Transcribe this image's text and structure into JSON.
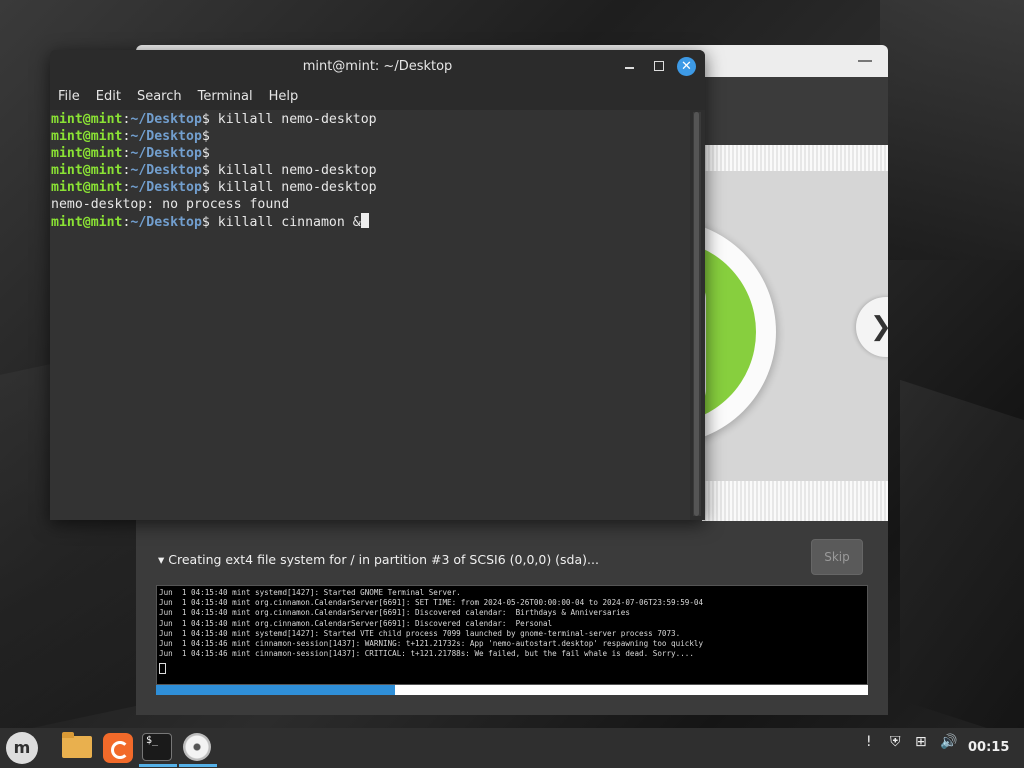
{
  "terminal": {
    "title": "mint@mint: ~/Desktop",
    "menu": [
      "File",
      "Edit",
      "Search",
      "Terminal",
      "Help"
    ],
    "prompt": {
      "user": "mint@mint",
      "sep": ":",
      "path": "~/Desktop",
      "symbol": "$"
    },
    "lines": [
      {
        "type": "prompt",
        "cmd": " killall nemo-desktop"
      },
      {
        "type": "prompt",
        "cmd": ""
      },
      {
        "type": "prompt",
        "cmd": ""
      },
      {
        "type": "prompt",
        "cmd": " killall nemo-desktop"
      },
      {
        "type": "prompt",
        "cmd": " killall nemo-desktop"
      },
      {
        "type": "output",
        "text": "nemo-desktop: no process found"
      },
      {
        "type": "prompt",
        "cmd": " killall cinnamon &",
        "cursor": true
      }
    ]
  },
  "installer": {
    "progress_title": "▾ Creating ext4 file system for / in partition #3 of SCSI6 (0,0,0) (sda)...",
    "skip_label": "Skip",
    "progress_fraction": 0.335,
    "log": [
      "Jun  1 04:15:40 mint systemd[1427]: Started GNOME Terminal Server.",
      "Jun  1 04:15:40 mint org.cinnamon.CalendarServer[6691]: SET TIME: from 2024-05-26T00:00:00-04 to 2024-07-06T23:59:59-04",
      "Jun  1 04:15:40 mint org.cinnamon.CalendarServer[6691]: Discovered calendar:  Birthdays & Anniversaries",
      "Jun  1 04:15:40 mint org.cinnamon.CalendarServer[6691]: Discovered calendar:  Personal",
      "Jun  1 04:15:40 mint systemd[1427]: Started VTE child process 7099 launched by gnome-terminal-server process 7073.",
      "Jun  1 04:15:46 mint cinnamon-session[1437]: WARNING: t+121.21732s: App 'nemo-autostart.desktop' respawning too quickly",
      "Jun  1 04:15:46 mint cinnamon-session[1437]: CRITICAL: t+121.21788s: We failed, but the fail whale is dead. Sorry...."
    ]
  },
  "taskbar": {
    "clock": "00:15",
    "terminal_icon_text": "$_",
    "menu_glyph": "m"
  },
  "icons": {
    "next": "❯",
    "close": "✕",
    "notification": "!",
    "shield": "⛨",
    "network": "⊞",
    "volume": "🔊"
  },
  "colors": {
    "prompt_user": "#8ae234",
    "prompt_path": "#729fcf",
    "progress": "#2f8fd8",
    "accent": "#3d9ae6"
  }
}
